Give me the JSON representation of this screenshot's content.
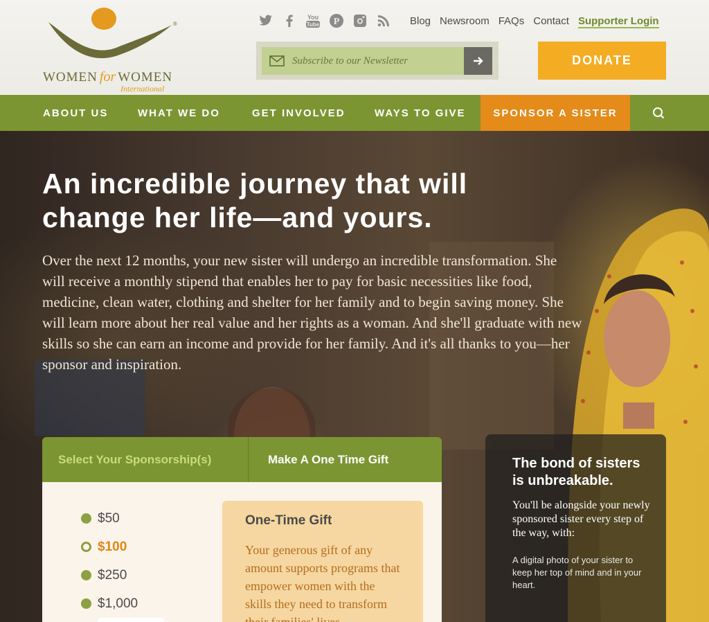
{
  "brand": {
    "word_left": "WOMEN",
    "word_for": "for",
    "word_right": "WOMEN",
    "word_intl": "International",
    "registered": "®",
    "colors": {
      "green": "#7c9533",
      "orange": "#e48b1a",
      "gold": "#f4ac22",
      "olive": "#6a6b38"
    }
  },
  "social": [
    "twitter-icon",
    "facebook-icon",
    "youtube-icon",
    "pinterest-icon",
    "instagram-icon",
    "rss-icon"
  ],
  "top_links": {
    "blog": "Blog",
    "newsroom": "Newsroom",
    "faqs": "FAQs",
    "contact": "Contact",
    "login": "Supporter Login"
  },
  "newsletter": {
    "placeholder": "Subscribe to our Newsletter"
  },
  "donate": {
    "label": "DONATE"
  },
  "nav": {
    "about": "ABOUT US",
    "what": "WHAT WE DO",
    "involved": "GET INVOLVED",
    "give": "WAYS TO GIVE",
    "sponsor": "SPONSOR A SISTER"
  },
  "hero": {
    "title_line1": "An incredible journey that will",
    "title_line2": "change her life—and yours.",
    "body": "Over the next 12 months, your new sister will undergo an incredible transformation. She will receive a monthly stipend that enables her to pay for basic necessities like food, medicine, clean water, clothing and shelter for her family and to begin saving money. She will learn more about her real value and her rights as a woman. And she'll graduate with new skills so she can earn an income and provide for her family. And it's all thanks to you—her sponsor and inspiration."
  },
  "sponsor_panel": {
    "tab_sponsorship": "Select Your Sponsorship(s)",
    "tab_one_time": "Make A One Time Gift",
    "amounts": [
      "$50",
      "$100",
      "$250",
      "$1,000"
    ],
    "selected_amount": "$100",
    "gift_title": "One-Time Gift",
    "gift_text": "Your generous gift of any amount supports programs that empower women with the skills they need to transform their families' lives."
  },
  "bond": {
    "title": "The bond of sisters is unbreakable.",
    "text": "You'll be alongside your newly sponsored sister every step of the way, with:",
    "item1": "A digital photo of your sister to keep her top of mind and in your heart."
  }
}
